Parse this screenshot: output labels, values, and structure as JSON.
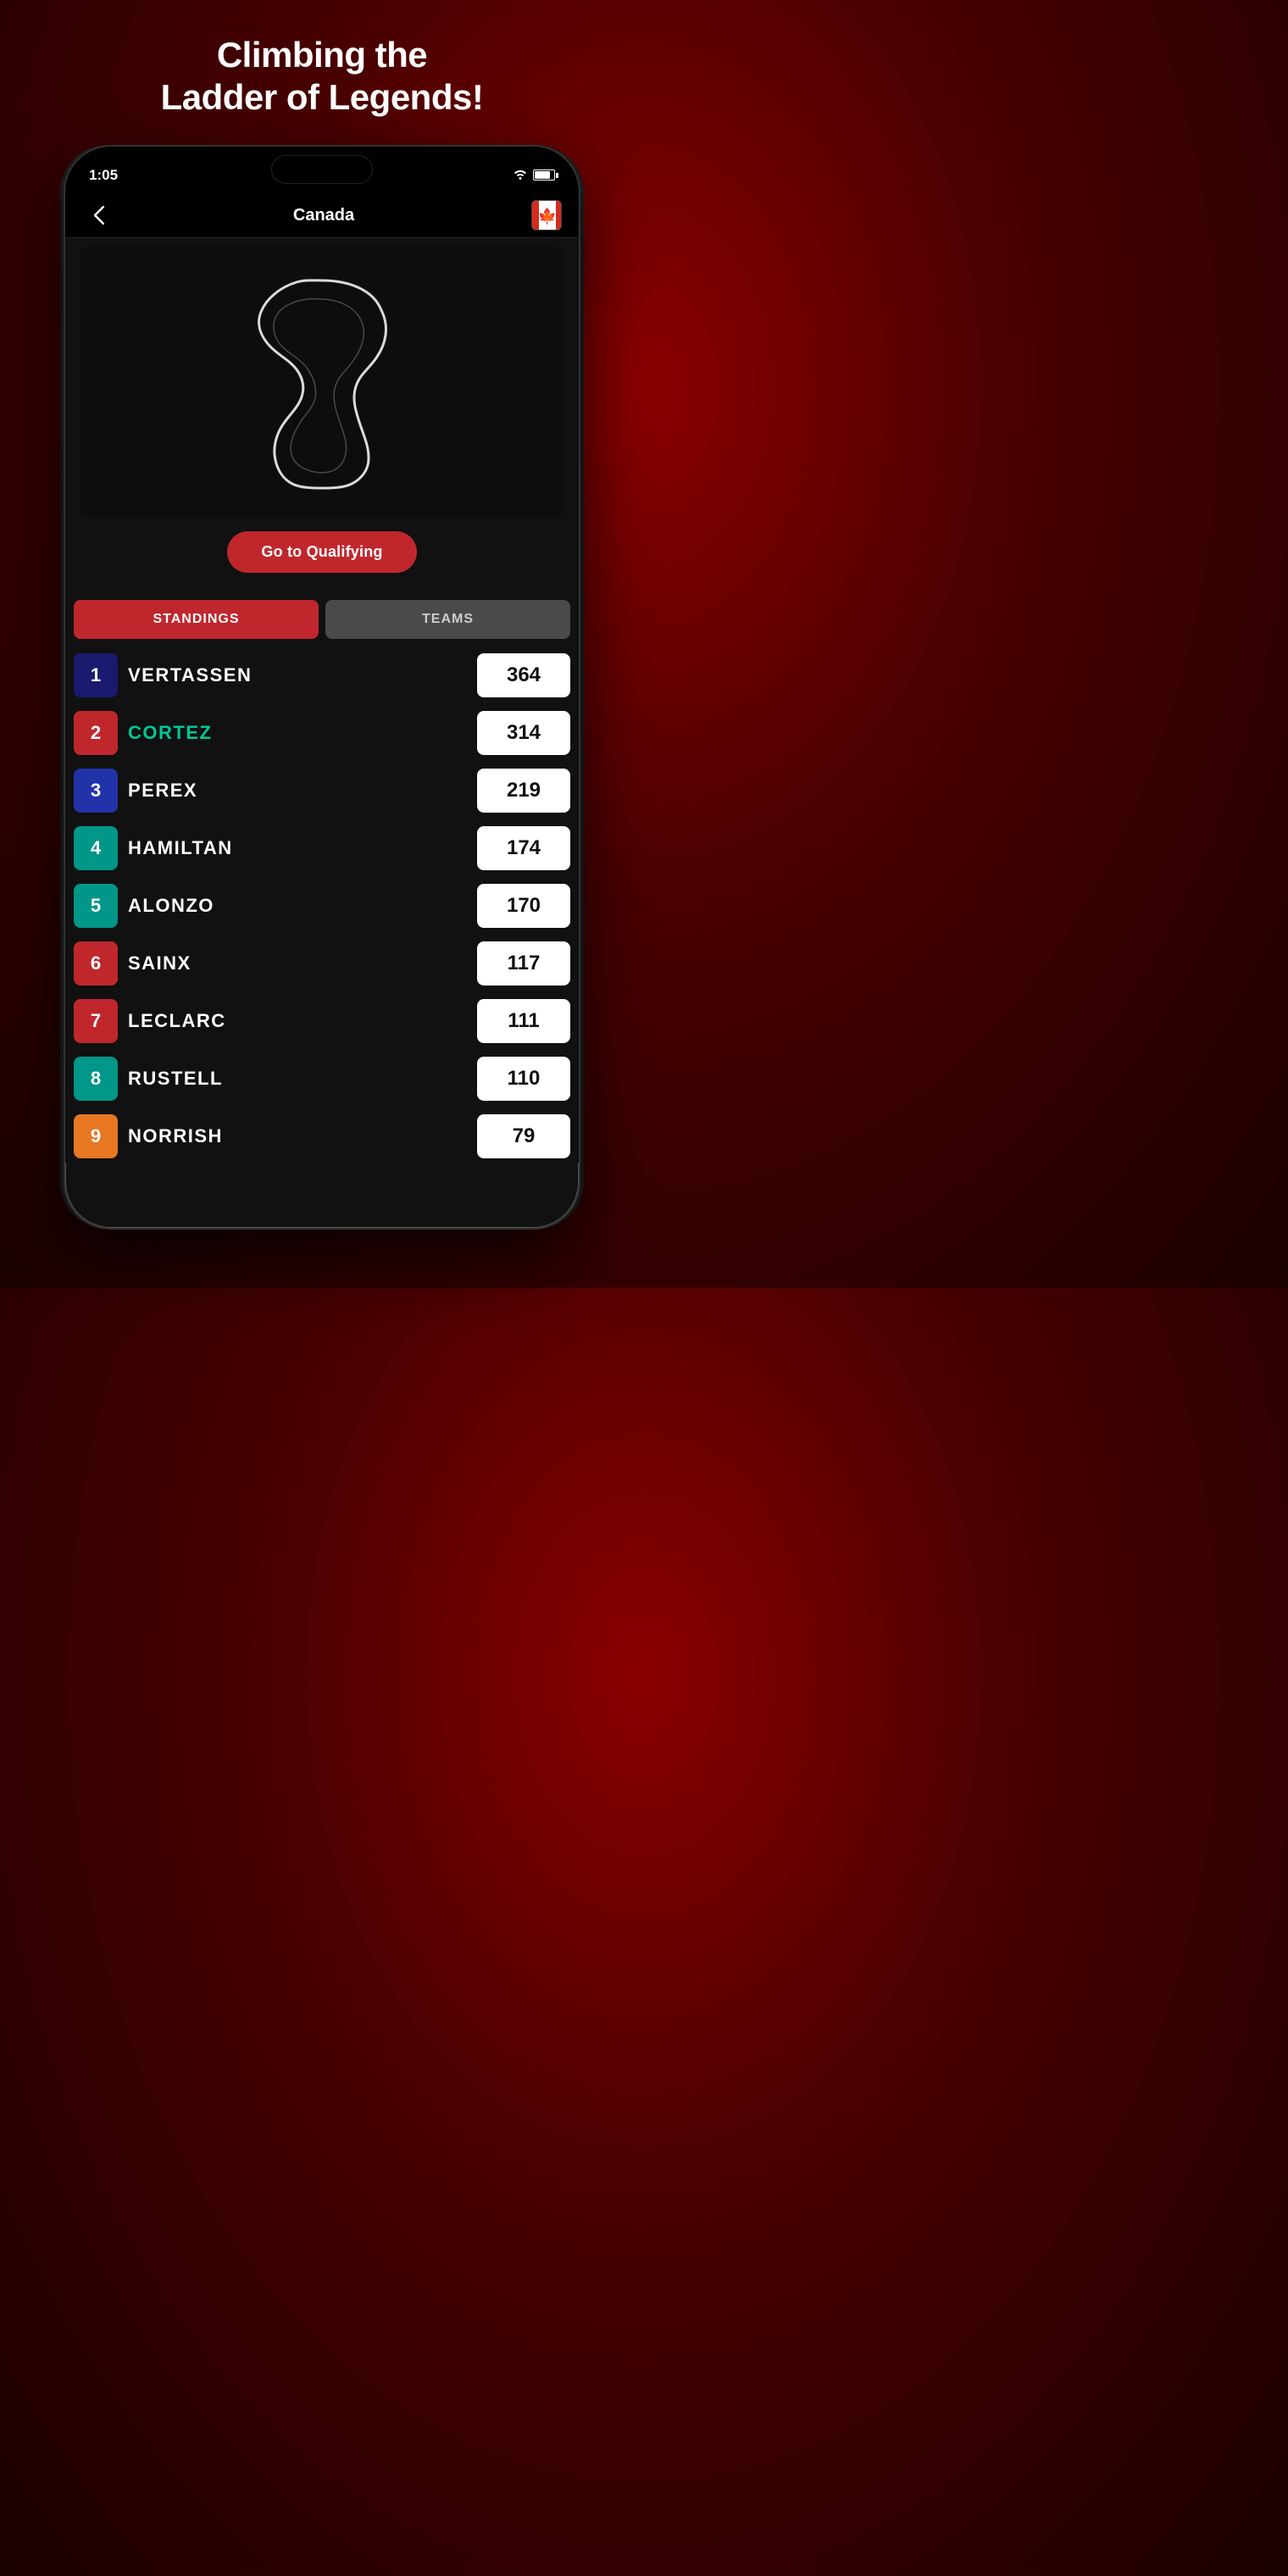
{
  "page": {
    "title_line1": "Climbing the",
    "title_line2": "Ladder of Legends!"
  },
  "status_bar": {
    "time": "1:05"
  },
  "nav": {
    "title": "Canada",
    "back_label": "<"
  },
  "track": {
    "button_label": "Go to Qualifying"
  },
  "tabs": {
    "standings_label": "STANDINGS",
    "teams_label": "TEAMS"
  },
  "standings": [
    {
      "pos": "1",
      "name": "VERTASSEN",
      "points": "364",
      "color_class": "pos-dark-blue",
      "highlight": false
    },
    {
      "pos": "2",
      "name": "CORTEZ",
      "points": "314",
      "color_class": "pos-red",
      "highlight": true
    },
    {
      "pos": "3",
      "name": "PEREX",
      "points": "219",
      "color_class": "pos-blue",
      "highlight": false
    },
    {
      "pos": "4",
      "name": "HAMILTAN",
      "points": "174",
      "color_class": "pos-teal",
      "highlight": false
    },
    {
      "pos": "5",
      "name": "ALONZO",
      "points": "170",
      "color_class": "pos-teal2",
      "highlight": false
    },
    {
      "pos": "6",
      "name": "SAINX",
      "points": "117",
      "color_class": "pos-red2",
      "highlight": false
    },
    {
      "pos": "7",
      "name": "LECLARC",
      "points": "111",
      "color_class": "pos-red3",
      "highlight": false
    },
    {
      "pos": "8",
      "name": "RUSTELL",
      "points": "110",
      "color_class": "pos-teal3",
      "highlight": false
    },
    {
      "pos": "9",
      "name": "NORRISH",
      "points": "79",
      "color_class": "pos-orange",
      "highlight": false
    }
  ]
}
